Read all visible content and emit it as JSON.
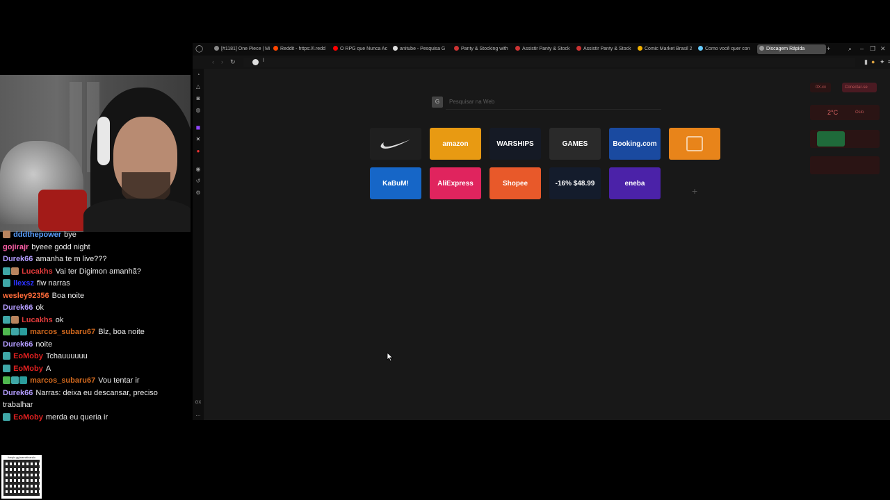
{
  "chat": [
    {
      "badges": [
        "gift"
      ],
      "user": "dddthepower",
      "color": "#5aa0ff",
      "text": "bye"
    },
    {
      "badges": [],
      "user": "gojirajr",
      "color": "#ff5fa8",
      "text": "byeee godd night"
    },
    {
      "badges": [],
      "user": "Durek66",
      "color": "#b39cff",
      "text": "amanha te m live???"
    },
    {
      "badges": [
        "sub",
        "gift"
      ],
      "user": "Lucakhs",
      "color": "#e23b3b",
      "text": "Vai ter Digimon amanhã?"
    },
    {
      "badges": [
        "sub"
      ],
      "user": "llexsz",
      "color": "#2b33ff",
      "text": "flw narras"
    },
    {
      "badges": [],
      "user": "wesley92356",
      "color": "#ff6b3a",
      "text": "Boa noite"
    },
    {
      "badges": [],
      "user": "Durek66",
      "color": "#b39cff",
      "text": "ok"
    },
    {
      "badges": [
        "sub",
        "gift"
      ],
      "user": "Lucakhs",
      "color": "#e23b3b",
      "text": "ok"
    },
    {
      "badges": [
        "green",
        "sub",
        "prime"
      ],
      "user": "marcos_subaru67",
      "color": "#d2691e",
      "text": "Blz, boa noite"
    },
    {
      "badges": [],
      "user": "Durek66",
      "color": "#b39cff",
      "text": "noite"
    },
    {
      "badges": [
        "sub"
      ],
      "user": "EoMoby",
      "color": "#e02020",
      "text": "Tchauuuuuu"
    },
    {
      "badges": [
        "sub"
      ],
      "user": "EoMoby",
      "color": "#e02020",
      "text": "A"
    },
    {
      "badges": [
        "green",
        "sub",
        "prime"
      ],
      "user": "marcos_subaru67",
      "color": "#d2691e",
      "text": "Vou tentar ir"
    },
    {
      "badges": [],
      "user": "Durek66",
      "color": "#b39cff",
      "text": "Narras: deixa eu descansar, preciso trabalhar"
    },
    {
      "badges": [
        "sub"
      ],
      "user": "EoMoby",
      "color": "#e02020",
      "text": "merda eu queria ir"
    }
  ],
  "qr": {
    "caption": "livepix.gg/narrativando"
  },
  "browser": {
    "tabs": [
      {
        "label": "[#1181] One Piece | Mi",
        "icon_color": "#888"
      },
      {
        "label": "Reddit - https://i.redd",
        "icon_color": "#ff4500"
      },
      {
        "label": "O RPG que Nunca Ac",
        "icon_color": "#ff0000"
      },
      {
        "label": "anitube - Pesquisa G",
        "icon_color": "#ddd"
      },
      {
        "label": "Panty & Stocking with",
        "icon_color": "#c33"
      },
      {
        "label": "Assistir Panty & Stock",
        "icon_color": "#c33"
      },
      {
        "label": "Assistir Panty & Stock",
        "icon_color": "#c33"
      },
      {
        "label": "Comic Market Brasil 2",
        "icon_color": "#f0b000"
      },
      {
        "label": "Como você quer con",
        "icon_color": "#6cf"
      },
      {
        "label": "Discagem Rápida",
        "icon_color": "#999",
        "active": true
      }
    ],
    "url": "l",
    "search_placeholder": "Pesquisar na Web",
    "search_g": "G",
    "speed_dial": [
      {
        "label": "nike-swoosh",
        "text": "",
        "bg": "#1f1f1f"
      },
      {
        "label": "amazon",
        "text": "amazon",
        "bg": "#e89a12"
      },
      {
        "label": "warships",
        "text": "WARSHIPS",
        "bg": "#151a25"
      },
      {
        "label": "gx-games",
        "text": "GAMES",
        "bg": "#2a2a2a"
      },
      {
        "label": "booking",
        "text": "Booking.com",
        "bg": "#1a4aa0"
      },
      {
        "label": "orange-tile",
        "text": "",
        "bg": "#e8841a"
      },
      {
        "label": "kabum",
        "text": "KaBuM!",
        "bg": "#1666c7"
      },
      {
        "label": "aliexpress",
        "text": "AliExpress",
        "bg": "#e0245e"
      },
      {
        "label": "shopee",
        "text": "Shopee",
        "bg": "#e8592a"
      },
      {
        "label": "game-deal",
        "text": "-16% $48.99",
        "bg": "#141c2c"
      },
      {
        "label": "eneba",
        "text": "eneba",
        "bg": "#4b22a8"
      }
    ],
    "widgets": {
      "top_left": "0X.xx",
      "top_right": "Conectar-se",
      "temp": "2°C",
      "weather_label": "Oslo"
    }
  }
}
